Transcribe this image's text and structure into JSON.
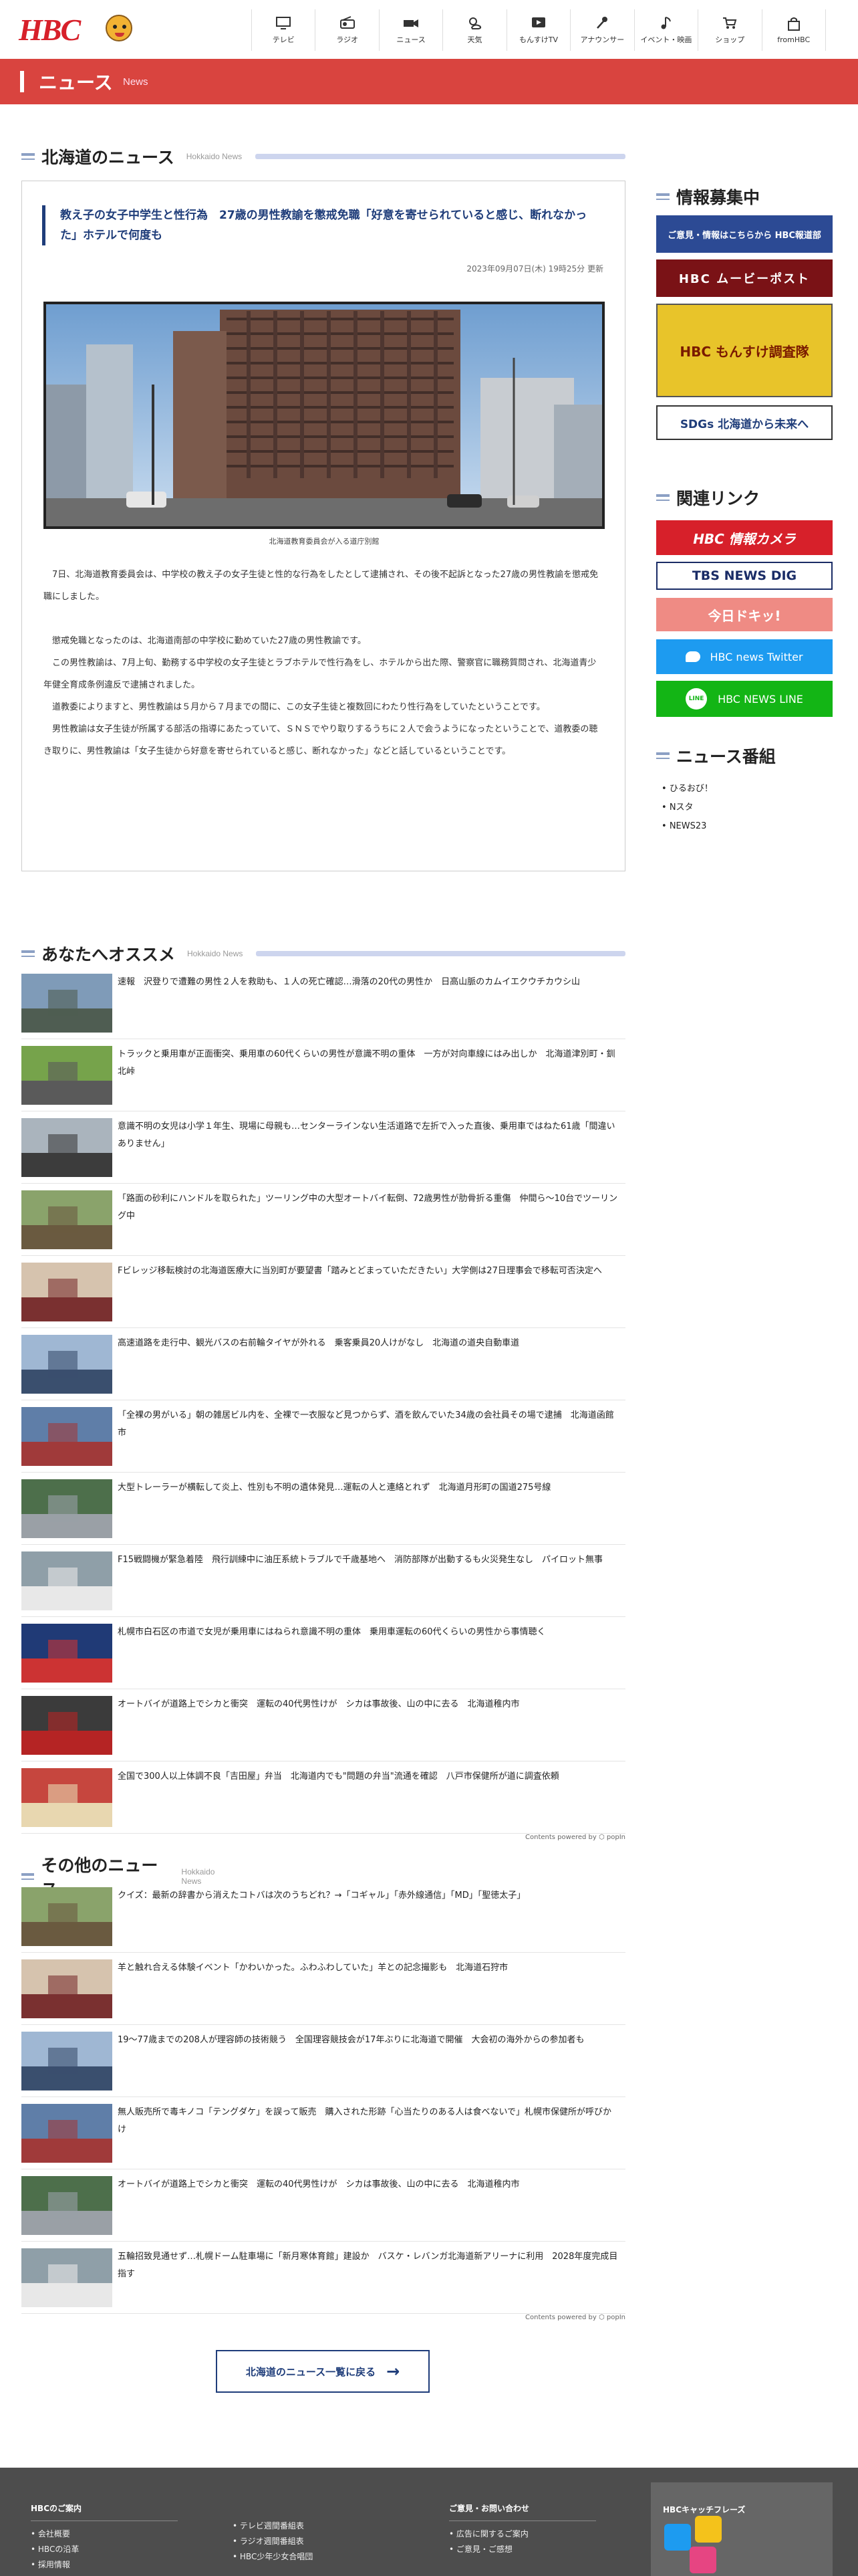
{
  "header": {
    "logo": "HBC",
    "nav": [
      {
        "label": "テレビ",
        "icon": "tv-icon"
      },
      {
        "label": "ラジオ",
        "icon": "radio-icon"
      },
      {
        "label": "ニュース",
        "icon": "news-camera-icon"
      },
      {
        "label": "天気",
        "icon": "weather-icon"
      },
      {
        "label": "もんすけTV",
        "icon": "play-icon"
      },
      {
        "label": "アナウンサー",
        "icon": "microphone-icon"
      },
      {
        "label": "イベント・映画",
        "icon": "music-note-icon"
      },
      {
        "label": "ショップ",
        "icon": "cart-icon"
      },
      {
        "label": "fromHBC",
        "icon": "bag-icon"
      }
    ]
  },
  "band": {
    "title": "ニュース",
    "subtitle": "News"
  },
  "hokkaido_news": {
    "heading": "北海道のニュース",
    "heading_sub": "Hokkaido News",
    "article": {
      "title": "教え子の女子中学生と性行為　27歳の男性教諭を懲戒免職「好意を寄せられていると感じ、断れなかった」ホテルで何度も",
      "date": "2023年09月07日(木) 19時25分 更新",
      "caption": "北海道教育委員会が入る道庁別館",
      "paragraphs": [
        "　7日、北海道教育委員会は、中学校の教え子の女子生徒と性的な行為をしたとして逮捕され、その後不起訴となった27歳の男性教諭を懲戒免職にしました。",
        "",
        "　懲戒免職となったのは、北海道南部の中学校に勤めていた27歳の男性教諭です。",
        "　この男性教諭は、7月上旬、勤務する中学校の女子生徒とラブホテルで性行為をし、ホテルから出た際、警察官に職務質問され、北海道青少年健全育成条例違反で逮捕されました。",
        "　道教委によりますと、男性教諭は５月から７月までの間に、この女子生徒と複数回にわたり性行為をしていたということです。",
        "　男性教諭は女子生徒が所属する部活の指導にあたっていて、ＳＮＳでやり取りするうちに２人で会うようになったということで、道教委の聴き取りに、男性教諭は「女子生徒から好意を寄せられていると感じ、断れなかった」などと話しているということです。"
      ]
    }
  },
  "sidebar": {
    "recruit_heading": "情報募集中",
    "banners": [
      {
        "text": "ご意見・情報はこちらから HBC報道部",
        "color": "#2c4a94"
      },
      {
        "text": "HBC ムービーポスト",
        "color": "#7a1216"
      },
      {
        "text": "HBC もんすけ調査隊",
        "color": "#e8c42a"
      },
      {
        "text": "SDGs 北海道から未来へ",
        "color": "#ffffff"
      }
    ],
    "links_heading": "関連リンク",
    "links": [
      {
        "text": "HBC 情報カメラ",
        "color": "#d7202a"
      },
      {
        "text": "TBS NEWS DIG",
        "color": "#ffffff"
      },
      {
        "text": "今日ドキッ!",
        "color": "#ef8b84"
      },
      {
        "text": "HBC news Twitter",
        "color": "#1d9bf0"
      },
      {
        "text": "HBC NEWS LINE",
        "color": "#13b515"
      }
    ],
    "programs_heading": "ニュース番組",
    "programs": [
      "ひるおび！",
      "Nスタ",
      "NEWS23"
    ]
  },
  "recommend": {
    "heading": "あなたへオススメ",
    "heading_sub": "Hokkaido News",
    "powered": "Contents powered by ⬡ popIn",
    "items": [
      "速報　沢登りで遭難の男性２人を救助も、１人の死亡確認…滑落の20代の男性か　日高山脈のカムイエクウチカウシ山",
      "トラックと乗用車が正面衝突、乗用車の60代くらいの男性が意識不明の重体　一方が対向車線にはみ出しか　北海道津別町・釧北峠",
      "意識不明の女児は小学１年生、現場に母親も…センターラインない生活道路で左折で入った直後、乗用車ではねた61歳「間違いありません」",
      "「路面の砂利にハンドルを取られた」ツーリング中の大型オートバイ転倒、72歳男性が肋骨折る重傷　仲間ら～10台でツーリング中",
      "Fビレッジ移転検討の北海道医療大に当別町が要望書「踏みとどまっていただきたい」大学側は27日理事会で移転可否決定へ",
      "高速道路を走行中、観光バスの右前輪タイヤが外れる　乗客乗員20人けがなし　北海道の道央自動車道",
      "「全裸の男がいる」朝の雑居ビル内を、全裸で一衣服など見つからず、酒を飲んでいた34歳の会社員その場で逮捕　北海道函館市",
      "大型トレーラーが横転して炎上、性別も不明の遺体発見…運転の人と連絡とれず　北海道月形町の国道275号線",
      "F15戦闘機が緊急着陸　飛行訓練中に油圧系統トラブルで千歳基地へ　消防部隊が出動するも火災発生なし　パイロット無事",
      "札幌市白石区の市道で女児が乗用車にはねられ意識不明の重体　乗用車運転の60代くらいの男性から事情聴く",
      "オートバイが道路上でシカと衝突　運転の40代男性けが　シカは事故後、山の中に去る　北海道稚内市",
      "全国で300人以上体調不良「吉田屋」弁当　北海道内でも\"問題の弁当\"流通を確認　八戸市保健所が道に調査依頼"
    ]
  },
  "other": {
    "heading": "その他のニュース",
    "heading_sub": "Hokkaido News",
    "powered": "Contents powered by ⬡ popIn",
    "items": [
      "クイズ：最新の辞書から消えたコトバは次のうちどれ？→「コギャル」「赤外線通信」「MD」「聖徳太子」",
      "羊と触れ合える体験イベント「かわいかった。ふわふわしていた」羊との記念撮影も　北海道石狩市",
      "19～77歳までの208人が理容師の技術競う　全国理容競技会が17年ぶりに北海道で開催　大会初の海外からの参加者も",
      "無人販売所で毒キノコ「テングダケ」を誤って販売　購入された形跡「心当たりのある人は食べないで」札幌市保健所が呼びかけ",
      "オートバイが道路上でシカと衝突　運転の40代男性けが　シカは事故後、山の中に去る　北海道稚内市",
      "五輪招致見通せず…札幌ドーム駐車場に「新月寒体育館」建設か　バスケ・レバンガ北海道新アリーナに利用　2028年度完成目指す"
    ],
    "more_button": "北海道のニュース一覧に戻る"
  },
  "footer": {
    "col1_title": "HBCのご案内",
    "col1": [
      "会社概要",
      "HBCの沿革",
      "採用情報"
    ],
    "col2": [
      "テレビ週間番組表",
      "ラジオ週間番組表",
      "HBC少年少女合唱団"
    ],
    "col3_title": "ご意見・お問い合わせ",
    "col3": [
      "広告に関するご案内",
      "ご意見・ご感想"
    ],
    "catch_title": "HBCキャッチフレーズ"
  },
  "colors": {
    "accent": "#d9443f",
    "navy": "#1f3d7a",
    "heading_line": "#cdd5ee"
  }
}
